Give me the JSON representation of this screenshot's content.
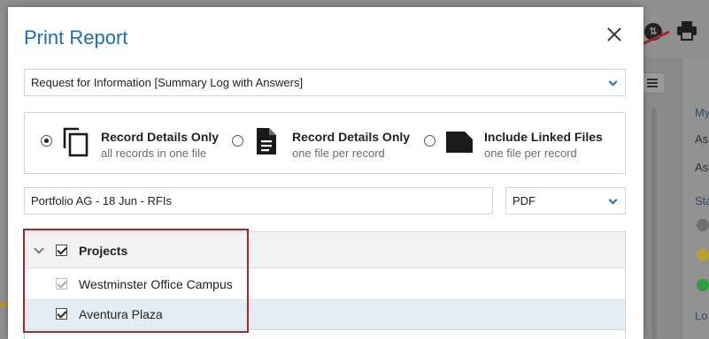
{
  "background": {
    "right_labels": [
      "My",
      "As",
      "As",
      "Sta",
      "Lo"
    ],
    "status_dot_colors": [
      "#6f6f6f",
      "#b8a22c",
      "#2f9e3c"
    ],
    "icons": [
      "sync-icon",
      "print-icon",
      "list-view-icon"
    ]
  },
  "modal": {
    "title": "Print Report",
    "report_type": {
      "value": "Request for Information [Summary Log with Answers]"
    },
    "options": [
      {
        "title": "Record Details Only",
        "subtitle": "all records in one file",
        "icon": "copy-icon",
        "selected": true
      },
      {
        "title": "Record Details Only",
        "subtitle": "one file per record",
        "icon": "document-icon",
        "selected": false
      },
      {
        "title": "Include Linked Files",
        "subtitle": "one file per record",
        "icon": "file-icon",
        "selected": false
      }
    ],
    "filename": {
      "value": "Portfolio AG - 18 Jun - RFIs"
    },
    "format": {
      "value": "PDF"
    },
    "tree": {
      "header": {
        "label": "Projects",
        "checked": true
      },
      "items": [
        {
          "label": "Westminster Office Campus",
          "checked": true,
          "disabled": true
        },
        {
          "label": "Aventura Plaza",
          "checked": true,
          "disabled": false
        }
      ]
    }
  },
  "colors": {
    "accent": "#1b6fb0",
    "annotation": "#a3262a"
  }
}
